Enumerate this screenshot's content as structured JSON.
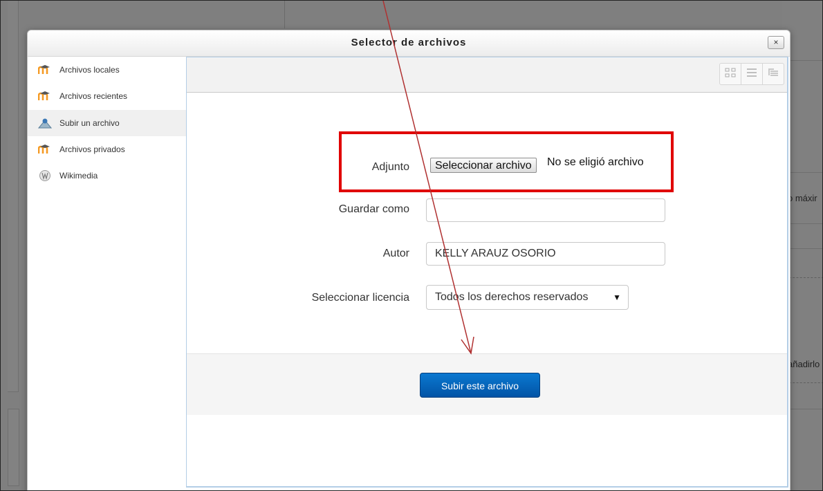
{
  "background_page": {
    "partial_text_1": "o máxir",
    "partial_text_2": "añadirlo"
  },
  "dialog": {
    "title": "Selector de archivos",
    "close_label": "×"
  },
  "sidebar": {
    "items": [
      {
        "label": "Archivos locales",
        "icon": "moodle-icon"
      },
      {
        "label": "Archivos recientes",
        "icon": "moodle-icon"
      },
      {
        "label": "Subir un archivo",
        "icon": "upload-icon",
        "active": true
      },
      {
        "label": "Archivos privados",
        "icon": "moodle-icon"
      },
      {
        "label": "Wikimedia",
        "icon": "wikimedia-icon"
      }
    ]
  },
  "toolbar": {
    "view_buttons": [
      "grid-view-icon",
      "list-view-icon",
      "tree-view-icon"
    ]
  },
  "form": {
    "attachment_label": "Adjunto",
    "file_button_label": "Seleccionar archivo",
    "file_status": "No se eligió archivo",
    "save_as_label": "Guardar como",
    "save_as_value": "",
    "author_label": "Autor",
    "author_value": "KELLY ARAUZ OSORIO",
    "license_label": "Seleccionar licencia",
    "license_value": "Todos los derechos reservados",
    "submit_label": "Subir este archivo"
  },
  "colors": {
    "highlight": "#e00000",
    "annotation_arrow": "#b03030",
    "submit_button": "#0a63b8"
  }
}
